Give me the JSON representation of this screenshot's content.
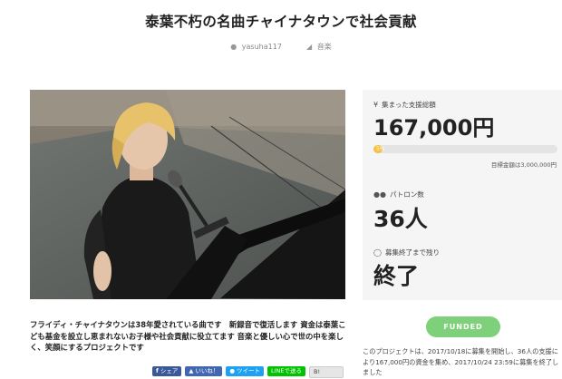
{
  "page": {
    "title": "泰葉不朽の名曲チャイナタウンで社会貢献",
    "author": "yasuha117",
    "category": "音楽"
  },
  "description": "フライディ・チャイナタウンは38年愛されている曲です　新録音で復活します 資金は泰葉こども基金を設立し恵まれないお子様や社会貢献に役立てます 音楽と優しい心で世の中を楽しく、笑顔にするプロジェクトです",
  "share_buttons": {
    "facebook": "シェア",
    "like": "いいね！",
    "tweet": "ツイート",
    "line": "LINEで送る",
    "hatena": "このエントリーをはてなブックマークに追加"
  },
  "stats": {
    "raised_label": "集まった支援総額",
    "raised_amount": "167,000円",
    "progress_percent": 5,
    "progress_text": "5%",
    "target_text": "目標金額は3,000,000円",
    "patrons_label": "パトロン数",
    "patrons_count": "36人",
    "remaining_label": "募集終了まで残り",
    "remaining_value": "終了"
  },
  "status": {
    "badge": "FUNDED",
    "note": "このプロジェクトは、2017/10/18に募集を開始し、36人の支援により167,000円の資金を集め、2017/10/24 23:59に募集を終了しました"
  },
  "colors": {
    "progress": "#f6c23e",
    "funded": "#7ed07a",
    "sidebar_bg": "#f5f5f5"
  }
}
